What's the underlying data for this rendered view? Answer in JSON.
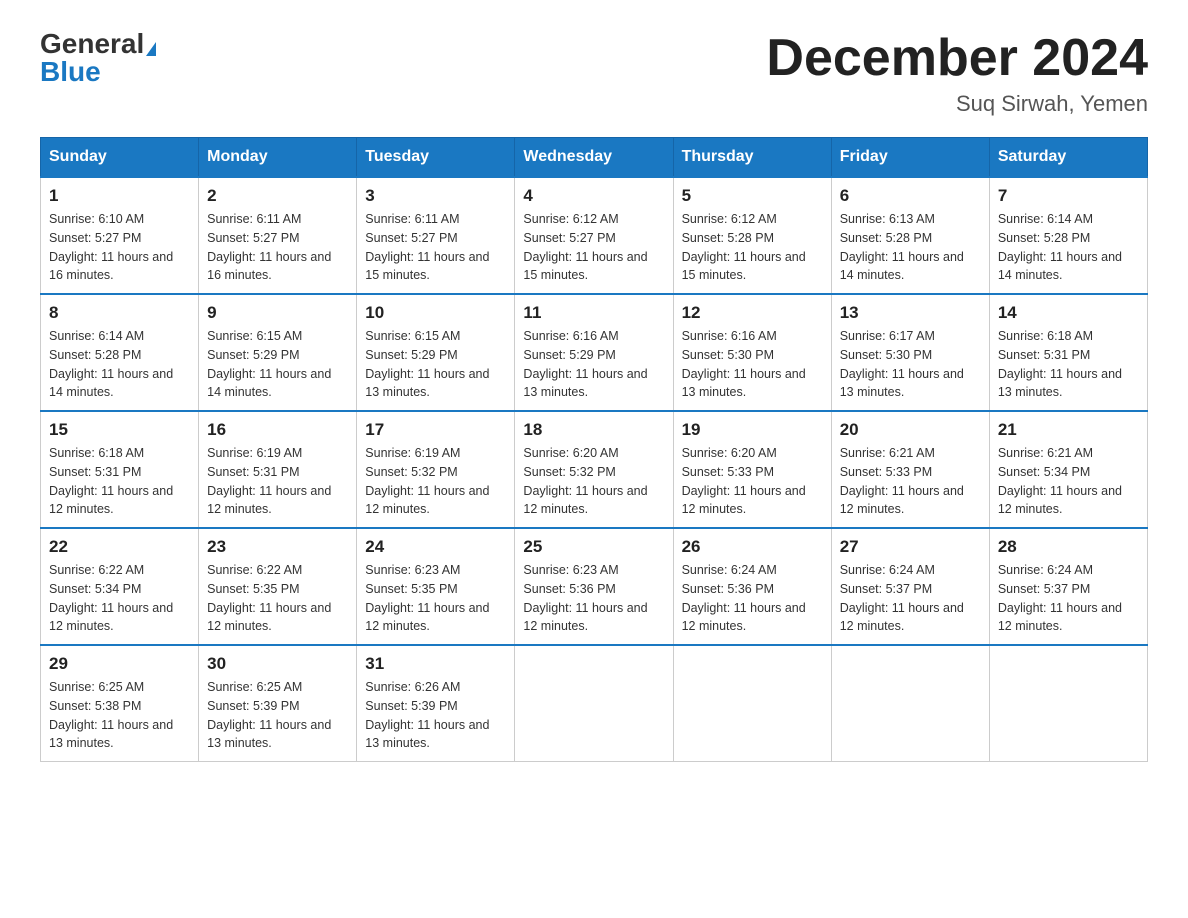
{
  "header": {
    "logo_general": "General",
    "logo_blue": "Blue",
    "main_title": "December 2024",
    "subtitle": "Suq Sirwah, Yemen"
  },
  "calendar": {
    "days_of_week": [
      "Sunday",
      "Monday",
      "Tuesday",
      "Wednesday",
      "Thursday",
      "Friday",
      "Saturday"
    ],
    "weeks": [
      [
        {
          "day": 1,
          "sunrise": "6:10 AM",
          "sunset": "5:27 PM",
          "daylight": "11 hours and 16 minutes."
        },
        {
          "day": 2,
          "sunrise": "6:11 AM",
          "sunset": "5:27 PM",
          "daylight": "11 hours and 16 minutes."
        },
        {
          "day": 3,
          "sunrise": "6:11 AM",
          "sunset": "5:27 PM",
          "daylight": "11 hours and 15 minutes."
        },
        {
          "day": 4,
          "sunrise": "6:12 AM",
          "sunset": "5:27 PM",
          "daylight": "11 hours and 15 minutes."
        },
        {
          "day": 5,
          "sunrise": "6:12 AM",
          "sunset": "5:28 PM",
          "daylight": "11 hours and 15 minutes."
        },
        {
          "day": 6,
          "sunrise": "6:13 AM",
          "sunset": "5:28 PM",
          "daylight": "11 hours and 14 minutes."
        },
        {
          "day": 7,
          "sunrise": "6:14 AM",
          "sunset": "5:28 PM",
          "daylight": "11 hours and 14 minutes."
        }
      ],
      [
        {
          "day": 8,
          "sunrise": "6:14 AM",
          "sunset": "5:28 PM",
          "daylight": "11 hours and 14 minutes."
        },
        {
          "day": 9,
          "sunrise": "6:15 AM",
          "sunset": "5:29 PM",
          "daylight": "11 hours and 14 minutes."
        },
        {
          "day": 10,
          "sunrise": "6:15 AM",
          "sunset": "5:29 PM",
          "daylight": "11 hours and 13 minutes."
        },
        {
          "day": 11,
          "sunrise": "6:16 AM",
          "sunset": "5:29 PM",
          "daylight": "11 hours and 13 minutes."
        },
        {
          "day": 12,
          "sunrise": "6:16 AM",
          "sunset": "5:30 PM",
          "daylight": "11 hours and 13 minutes."
        },
        {
          "day": 13,
          "sunrise": "6:17 AM",
          "sunset": "5:30 PM",
          "daylight": "11 hours and 13 minutes."
        },
        {
          "day": 14,
          "sunrise": "6:18 AM",
          "sunset": "5:31 PM",
          "daylight": "11 hours and 13 minutes."
        }
      ],
      [
        {
          "day": 15,
          "sunrise": "6:18 AM",
          "sunset": "5:31 PM",
          "daylight": "11 hours and 12 minutes."
        },
        {
          "day": 16,
          "sunrise": "6:19 AM",
          "sunset": "5:31 PM",
          "daylight": "11 hours and 12 minutes."
        },
        {
          "day": 17,
          "sunrise": "6:19 AM",
          "sunset": "5:32 PM",
          "daylight": "11 hours and 12 minutes."
        },
        {
          "day": 18,
          "sunrise": "6:20 AM",
          "sunset": "5:32 PM",
          "daylight": "11 hours and 12 minutes."
        },
        {
          "day": 19,
          "sunrise": "6:20 AM",
          "sunset": "5:33 PM",
          "daylight": "11 hours and 12 minutes."
        },
        {
          "day": 20,
          "sunrise": "6:21 AM",
          "sunset": "5:33 PM",
          "daylight": "11 hours and 12 minutes."
        },
        {
          "day": 21,
          "sunrise": "6:21 AM",
          "sunset": "5:34 PM",
          "daylight": "11 hours and 12 minutes."
        }
      ],
      [
        {
          "day": 22,
          "sunrise": "6:22 AM",
          "sunset": "5:34 PM",
          "daylight": "11 hours and 12 minutes."
        },
        {
          "day": 23,
          "sunrise": "6:22 AM",
          "sunset": "5:35 PM",
          "daylight": "11 hours and 12 minutes."
        },
        {
          "day": 24,
          "sunrise": "6:23 AM",
          "sunset": "5:35 PM",
          "daylight": "11 hours and 12 minutes."
        },
        {
          "day": 25,
          "sunrise": "6:23 AM",
          "sunset": "5:36 PM",
          "daylight": "11 hours and 12 minutes."
        },
        {
          "day": 26,
          "sunrise": "6:24 AM",
          "sunset": "5:36 PM",
          "daylight": "11 hours and 12 minutes."
        },
        {
          "day": 27,
          "sunrise": "6:24 AM",
          "sunset": "5:37 PM",
          "daylight": "11 hours and 12 minutes."
        },
        {
          "day": 28,
          "sunrise": "6:24 AM",
          "sunset": "5:37 PM",
          "daylight": "11 hours and 12 minutes."
        }
      ],
      [
        {
          "day": 29,
          "sunrise": "6:25 AM",
          "sunset": "5:38 PM",
          "daylight": "11 hours and 13 minutes."
        },
        {
          "day": 30,
          "sunrise": "6:25 AM",
          "sunset": "5:39 PM",
          "daylight": "11 hours and 13 minutes."
        },
        {
          "day": 31,
          "sunrise": "6:26 AM",
          "sunset": "5:39 PM",
          "daylight": "11 hours and 13 minutes."
        },
        null,
        null,
        null,
        null
      ]
    ]
  }
}
